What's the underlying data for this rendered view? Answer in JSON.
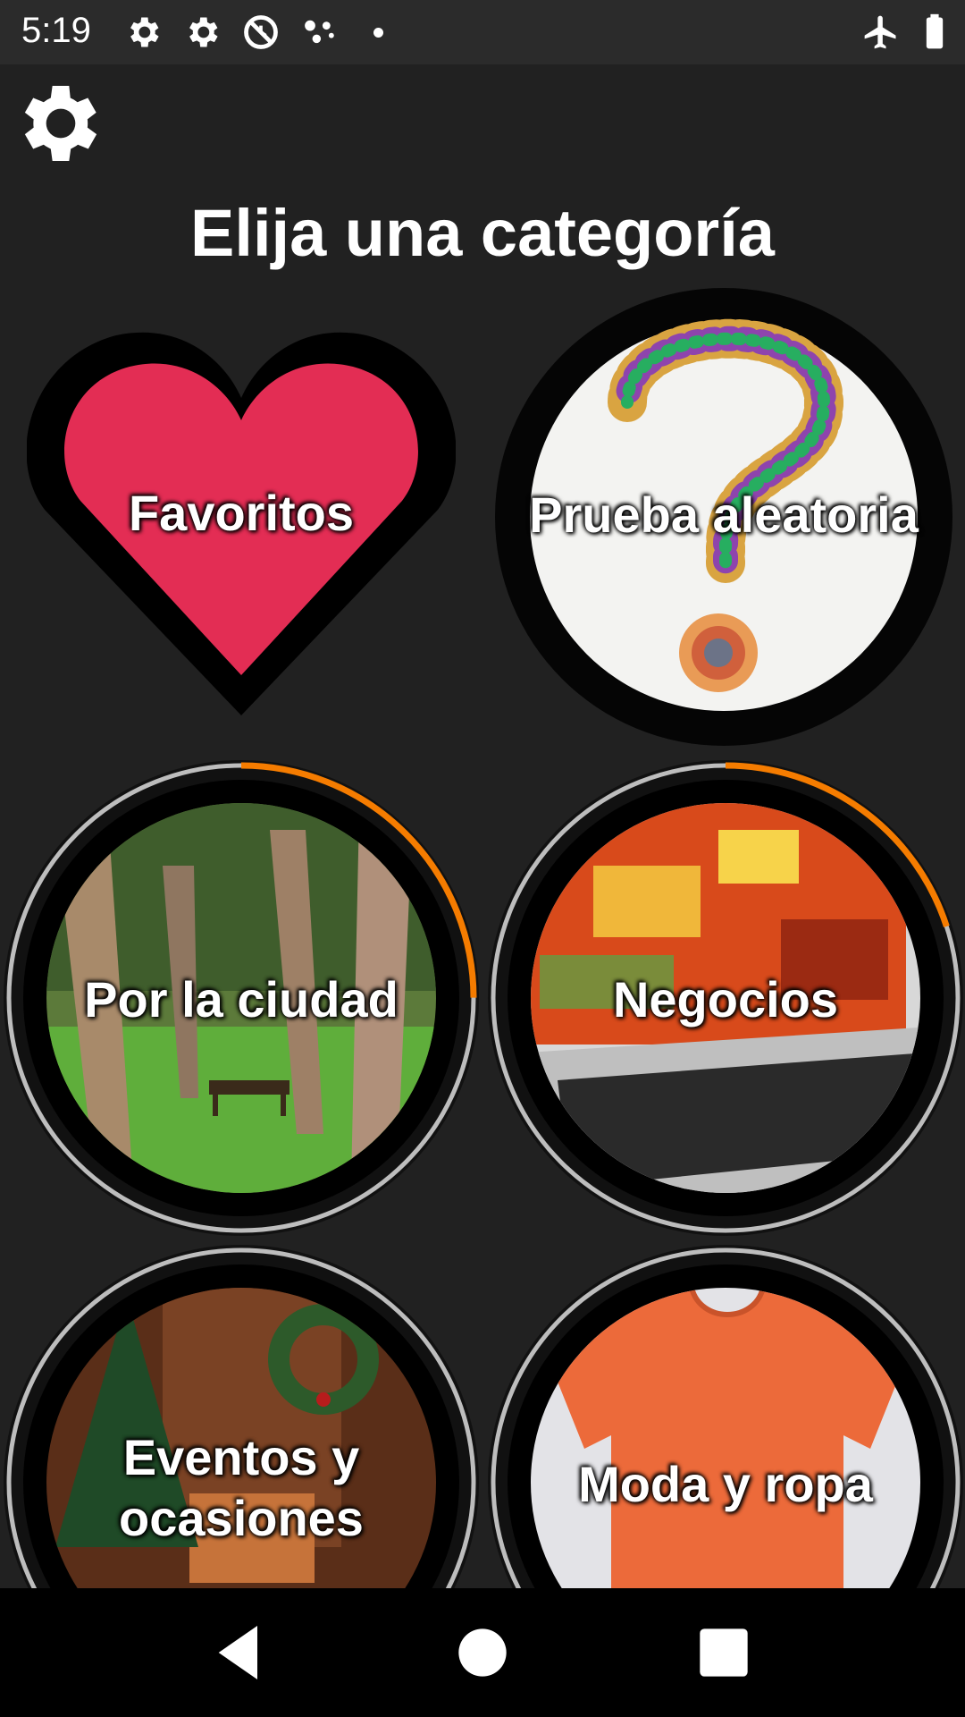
{
  "status_bar": {
    "time": "5:19",
    "icons": [
      "gear-icon",
      "gear-icon",
      "do-not-disturb-icon",
      "assistant-icon",
      "dot-icon",
      "airplane-icon",
      "battery-icon"
    ]
  },
  "settings": {
    "icon": "gear-icon"
  },
  "title": "Elija una categoría",
  "categories": [
    {
      "label": "Favoritos",
      "image": "heart",
      "color": "#e32d54"
    },
    {
      "label": "Prueba aleatoria",
      "image": "question-mark-mosaic"
    },
    {
      "label": "Por la ciudad",
      "image": "park-trees-bench",
      "progress": 0.25
    },
    {
      "label": "Negocios",
      "image": "laptop",
      "progress": 0.2
    },
    {
      "label_line1": "Eventos y",
      "label_line2": "ocasiones",
      "image": "christmas-room"
    },
    {
      "label": "Moda y ropa",
      "image": "orange-tshirt"
    }
  ],
  "colors": {
    "background": "#212121",
    "accent": "#f57c00",
    "heart": "#e32d54"
  },
  "nav_bar": {
    "icons": [
      "back-icon",
      "home-icon",
      "recents-icon"
    ]
  }
}
